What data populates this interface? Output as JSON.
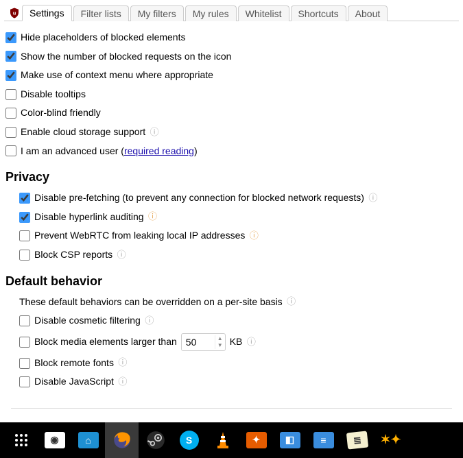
{
  "tabs": {
    "settings": "Settings",
    "filterlists": "Filter lists",
    "myfilters": "My filters",
    "myrules": "My rules",
    "whitelist": "Whitelist",
    "shortcuts": "Shortcuts",
    "about": "About"
  },
  "general": {
    "hide_placeholders": "Hide placeholders of blocked elements",
    "show_count": "Show the number of blocked requests on the icon",
    "context_menu": "Make use of context menu where appropriate",
    "disable_tooltips": "Disable tooltips",
    "color_blind": "Color-blind friendly",
    "cloud_storage": "Enable cloud storage support",
    "advanced_pre": "I am an advanced user (",
    "advanced_link": "required reading",
    "advanced_post": ")"
  },
  "privacy": {
    "title": "Privacy",
    "prefetch": "Disable pre-fetching (to prevent any connection for blocked network requests)",
    "hyperlink_audit": "Disable hyperlink auditing",
    "webrtc": "Prevent WebRTC from leaking local IP addresses",
    "csp": "Block CSP reports"
  },
  "default": {
    "title": "Default behavior",
    "desc": "These default behaviors can be overridden on a per-site basis",
    "cosmetic": "Disable cosmetic filtering",
    "media_pre": "Block media elements larger than",
    "media_value": "50",
    "media_unit": "KB",
    "remote_fonts": "Block remote fonts",
    "disable_js": "Disable JavaScript"
  },
  "checked": {
    "hide_placeholders": true,
    "show_count": true,
    "context_menu": true,
    "disable_tooltips": false,
    "color_blind": false,
    "cloud_storage": false,
    "advanced": false,
    "prefetch": true,
    "hyperlink_audit": true,
    "webrtc": false,
    "csp": false,
    "cosmetic": false,
    "media": false,
    "remote_fonts": false,
    "disable_js": false
  }
}
